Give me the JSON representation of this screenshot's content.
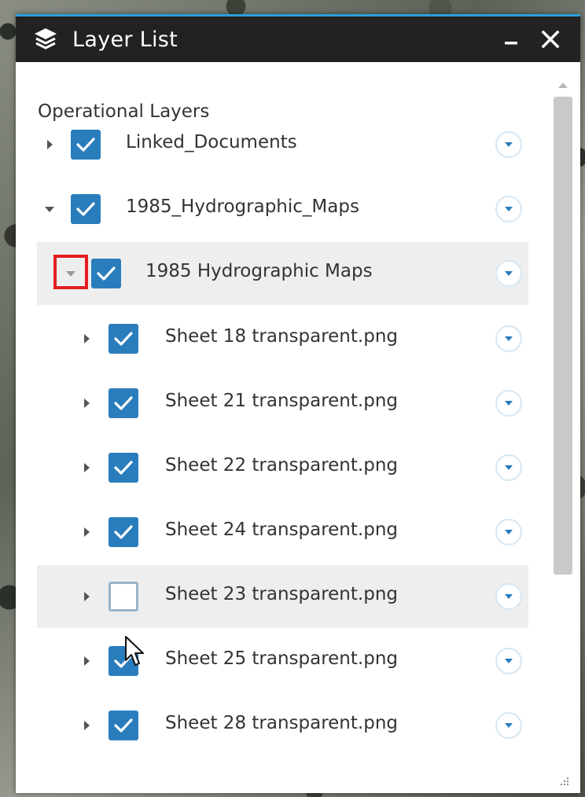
{
  "window": {
    "title": "Layer List",
    "minimize_symbol": "–",
    "close_symbol": "✕"
  },
  "section": {
    "title": "Operational Layers"
  },
  "layers": [
    {
      "label": "Linked_Documents",
      "level": 0,
      "expanded": false,
      "checked": true
    },
    {
      "label": "1985_Hydrographic_Maps",
      "level": 0,
      "expanded": true,
      "checked": true
    },
    {
      "label": "1985 Hydrographic Maps",
      "level": 1,
      "expanded": true,
      "checked": true,
      "highlighted": true
    },
    {
      "label": "Sheet 18 transparent.png",
      "level": 2,
      "expanded": false,
      "checked": true
    },
    {
      "label": "Sheet 21 transparent.png",
      "level": 2,
      "expanded": false,
      "checked": true
    },
    {
      "label": "Sheet 22 transparent.png",
      "level": 2,
      "expanded": false,
      "checked": true
    },
    {
      "label": "Sheet 24 transparent.png",
      "level": 2,
      "expanded": false,
      "checked": true
    },
    {
      "label": "Sheet 23 transparent.png",
      "level": 2,
      "expanded": false,
      "checked": false,
      "hovered": true
    },
    {
      "label": "Sheet 25 transparent.png",
      "level": 2,
      "expanded": false,
      "checked": true
    },
    {
      "label": "Sheet 28 transparent.png",
      "level": 2,
      "expanded": false,
      "checked": true
    }
  ],
  "colors": {
    "accent": "#2a7dbd",
    "titlebar": "#222222",
    "highlight_box": "#e31e24"
  },
  "icons": {
    "title": "layers-icon",
    "row_menu": "chevron-down-circle-icon",
    "cursor": "mouse-pointer-icon"
  }
}
